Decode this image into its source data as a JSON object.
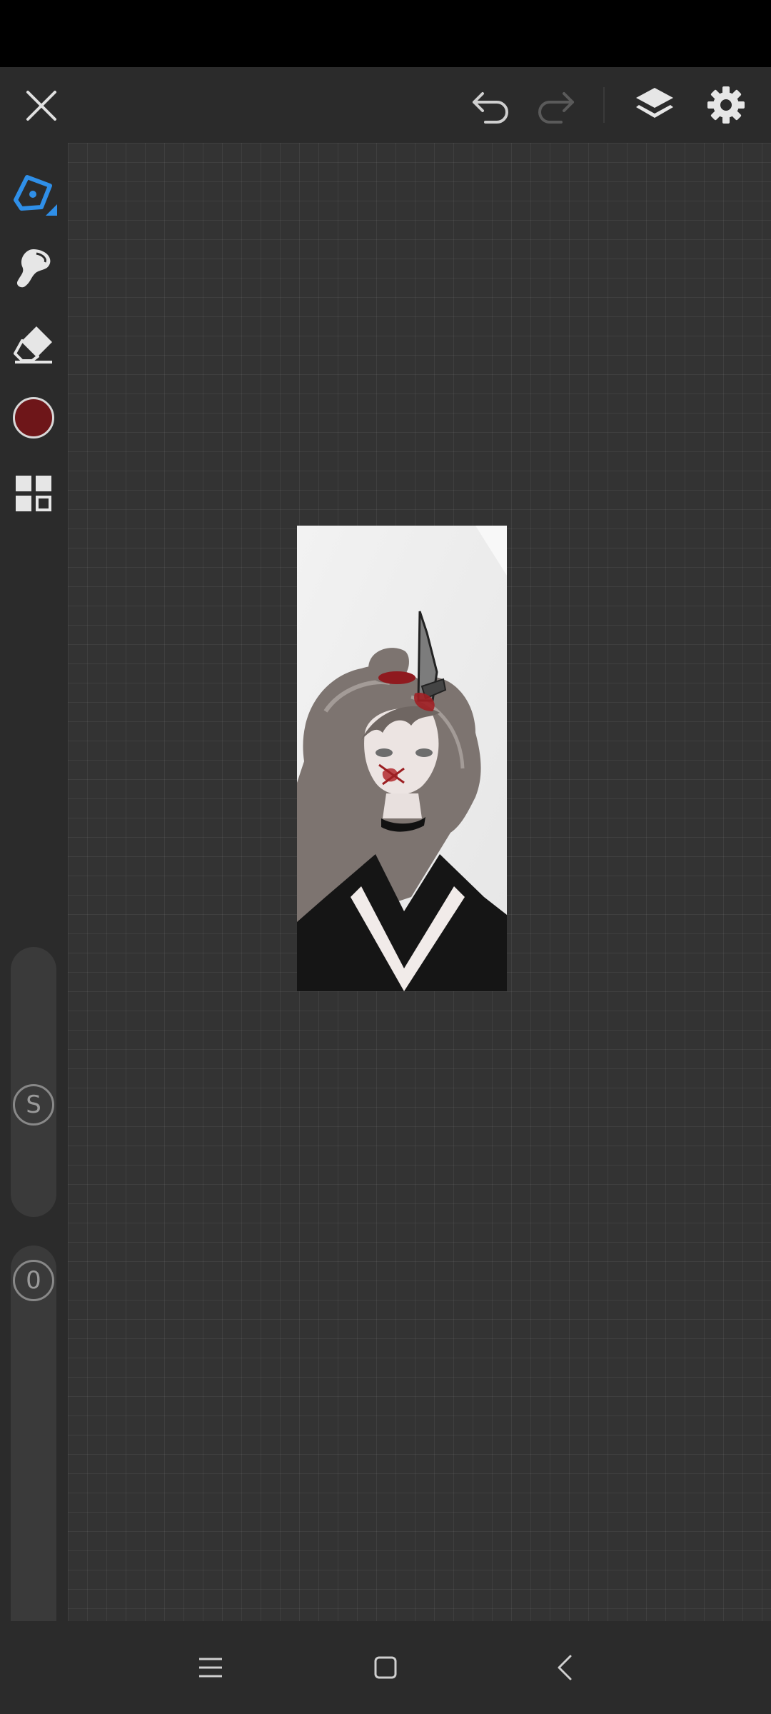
{
  "toolbar": {
    "close": "close",
    "undo": "undo",
    "redo": "redo",
    "layers": "layers",
    "settings": "settings"
  },
  "tools": {
    "pen": "pen-tool",
    "smudge": "smudge-tool",
    "eraser": "eraser-tool",
    "color_hex": "#6e1619",
    "layout": "layout-grid"
  },
  "sliders": {
    "size_label": "S",
    "opacity_value": "0"
  },
  "colors": {
    "accent": "#2f8fe8",
    "background": "#2b2b2b",
    "canvas_grid": "#333333"
  },
  "navbar": {
    "menu": "menu",
    "home": "home",
    "back": "back"
  }
}
